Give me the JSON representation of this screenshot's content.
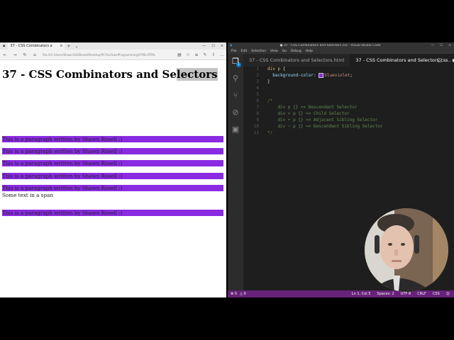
{
  "browser": {
    "tab_title": "37 - CSS Combinators a",
    "url": "file:///C:/Users/Shawn%20Rosell/Desktop/PC/YouTube/Programming/HTML/HTML",
    "page": {
      "heading_pre": "37 - CSS Combinators and Se",
      "heading_sel": "lectors",
      "paragraphs": [
        "This is a paragraph written by Shawn Rosell :)",
        "This is a paragraph written by Shawn Rosell :)",
        "This is a paragraph written by Shawn Rosell :)",
        "This is a paragraph written by Shawn Rosell :)",
        "This is a paragraph written by Shawn Rosell :)"
      ],
      "span_text": "Some text in a span",
      "last_paragraph": "This is a paragraph written by Shawn Rosell :)"
    }
  },
  "editor": {
    "window_title": "● 37 - CSS Combinators and Selectors.css - Visual Studio Code",
    "menu": [
      "File",
      "Edit",
      "Selection",
      "View",
      "Go",
      "Debug",
      "Help"
    ],
    "explorer_badge": "1",
    "tabs": [
      {
        "label": "37 - CSS Combinators and Selectors.html"
      },
      {
        "label": "37 - CSS Combinators and Selectors.css",
        "dirty": "●"
      }
    ],
    "line_numbers": [
      "1",
      "2",
      "3",
      "4",
      "5",
      "6",
      "7",
      "8",
      "9",
      "10",
      "11"
    ],
    "code": {
      "l1_sel": "div p",
      "l1_rest": " {",
      "l2_prop": "background-color",
      "l2_colon": ": ",
      "l2_val": "blueviolet",
      "l2_end": ";",
      "l3": "}",
      "l6": "/*",
      "l7": "    div p {} => Descendant Selector",
      "l8": "    div > p {} => Child Selector",
      "l9": "    div + p {} => Adjacent Sibling Selector",
      "l10": "    div ~ p {} => Descendant Sibling Selector",
      "l11": "*/"
    },
    "status": {
      "errors": "0",
      "warnings": "0",
      "position": "Ln 1, Col 5",
      "spaces": "Spaces: 2",
      "encoding": "UTF-8",
      "eol": "CRLF",
      "language": "CSS"
    }
  },
  "colors": {
    "paragraph_bg": "#8a2be2",
    "status_bar": "#68217a"
  }
}
